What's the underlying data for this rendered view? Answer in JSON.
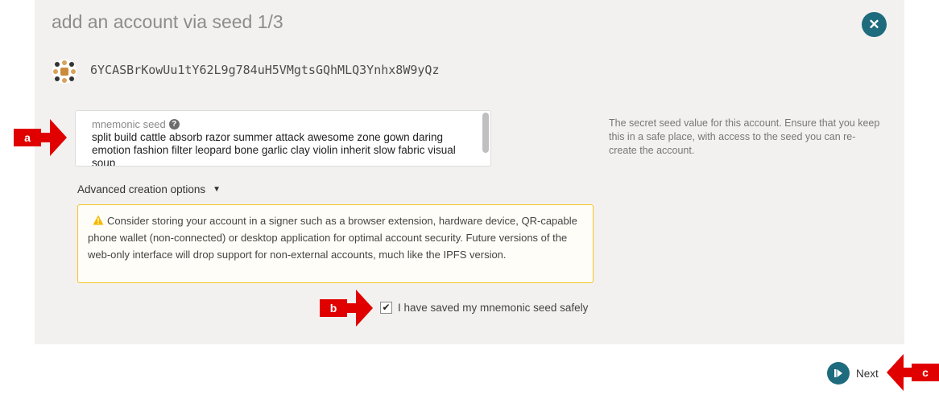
{
  "modal": {
    "title": "add an account via seed 1/3",
    "close_icon": "close-icon"
  },
  "account": {
    "address": "6YCASBrKowUu1tY62L9g784uH5VMgtsGQhMLQ3Ynhx8W9yQz",
    "identicon": "identicon"
  },
  "seed": {
    "label": "mnemonic seed",
    "help_icon": "question-circle-icon",
    "value": "split build cattle absorb razor summer attack awesome zone gown daring emotion fashion filter leopard bone garlic clay violin inherit slow fabric visual soup"
  },
  "help": {
    "text": "The secret seed value for this account. Ensure that you keep this in a safe place, with access to the seed you can re-create the account."
  },
  "advanced": {
    "label": "Advanced creation options",
    "icon": "caret-down-icon"
  },
  "warning": {
    "icon": "warning-triangle-icon",
    "text": "Consider storing your account in a signer such as a browser extension, hardware device, QR-capable phone wallet (non-connected) or desktop application for optimal account security. Future versions of the web-only interface will drop support for non-external accounts, much like the IPFS version."
  },
  "confirm": {
    "label": "I have saved my mnemonic seed safely",
    "checked": true
  },
  "footer": {
    "next_label": "Next",
    "next_icon": "step-forward-icon"
  },
  "callouts": {
    "a": "a",
    "b": "b",
    "c": "c",
    "color": "#e00000"
  },
  "colors": {
    "accent": "#1e6b7e",
    "warning_border": "#f5c326"
  }
}
